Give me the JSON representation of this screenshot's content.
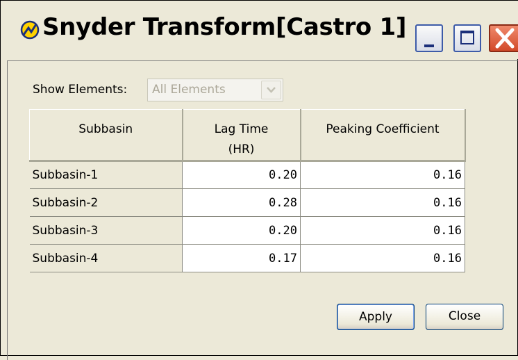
{
  "window": {
    "title": "Snyder Transform[Castro 1]",
    "accent_color": "#3d5ba8",
    "close_color": "#d24a2a",
    "title_icon": "hec-hms-icon"
  },
  "filter": {
    "label": "Show Elements:",
    "value": "All Elements"
  },
  "table": {
    "headers": [
      "Subbasin",
      "Lag Time\n(HR)",
      "Peaking Coefficient"
    ],
    "rows": [
      {
        "subbasin": "Subbasin-1",
        "lag_time": "0.20",
        "peaking_coefficient": "0.16"
      },
      {
        "subbasin": "Subbasin-2",
        "lag_time": "0.28",
        "peaking_coefficient": "0.16"
      },
      {
        "subbasin": "Subbasin-3",
        "lag_time": "0.20",
        "peaking_coefficient": "0.16"
      },
      {
        "subbasin": "Subbasin-4",
        "lag_time": "0.17",
        "peaking_coefficient": "0.16"
      }
    ]
  },
  "buttons": {
    "apply": "Apply",
    "close": "Close"
  }
}
